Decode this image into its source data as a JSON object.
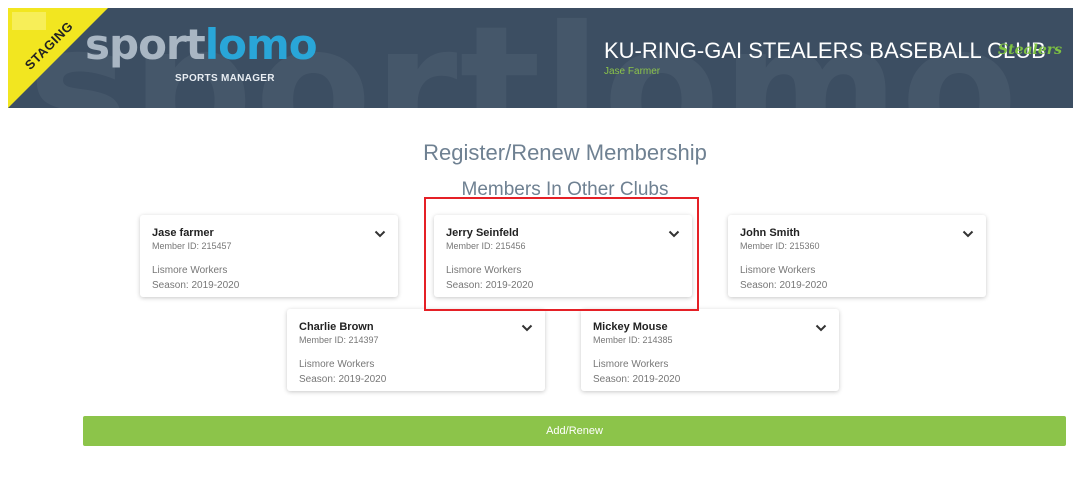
{
  "header": {
    "environment_badge": "STAGING",
    "logo_part1": "sport",
    "logo_part2": "lomo",
    "tagline": "SPORTS MANAGER",
    "club_name": "KU-RING-GAI STEALERS BASEBALL CLUB",
    "club_badge": "Stealers",
    "user_name": "Jase Farmer",
    "colors": {
      "header_bg": "#3c4e62",
      "staging": "#f2e620",
      "accent": "#8cc44a"
    }
  },
  "main": {
    "title": "Register/Renew Membership",
    "section_title": "Members In Other Clubs",
    "members": [
      {
        "name": "Jase farmer",
        "member_id": "Member ID: 215457",
        "club": "Lismore Workers",
        "season": "Season: 2019-2020",
        "icon": "chevron-down-icon"
      },
      {
        "name": "Jerry Seinfeld",
        "member_id": "Member ID: 215456",
        "club": "Lismore Workers",
        "season": "Season: 2019-2020",
        "icon": "chevron-down-icon",
        "highlighted": true
      },
      {
        "name": "John Smith",
        "member_id": "Member ID: 215360",
        "club": "Lismore Workers",
        "season": "Season: 2019-2020",
        "icon": "chevron-down-icon"
      },
      {
        "name": "Charlie Brown",
        "member_id": "Member ID: 214397",
        "club": "Lismore Workers",
        "season": "Season: 2019-2020",
        "icon": "chevron-down-icon"
      },
      {
        "name": "Mickey Mouse",
        "member_id": "Member ID: 214385",
        "club": "Lismore Workers",
        "season": "Season: 2019-2020",
        "icon": "chevron-down-icon"
      }
    ],
    "action_label": "Add/Renew"
  }
}
